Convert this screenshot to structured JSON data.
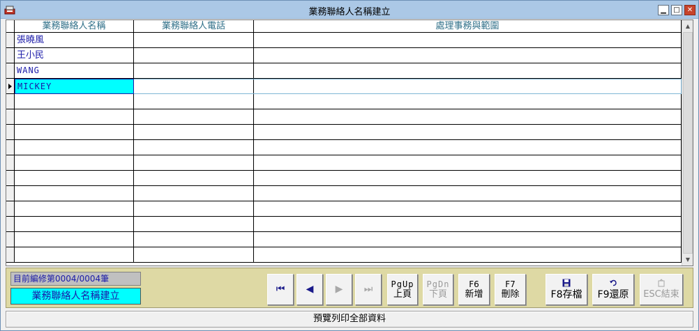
{
  "window": {
    "title": "業務聯絡人名稱建立",
    "min_glyph": "▁",
    "max_glyph": "□",
    "close_glyph": "✕"
  },
  "grid": {
    "headers": [
      "業務聯絡人名稱",
      "業務聯絡人電話",
      "處理事務與範圍"
    ],
    "rows": [
      {
        "name": "張曉風",
        "phone": "",
        "scope": ""
      },
      {
        "name": "王小民",
        "phone": "",
        "scope": ""
      },
      {
        "name": "WANG",
        "phone": "",
        "scope": ""
      },
      {
        "name": "MICKEY",
        "phone": "",
        "scope": ""
      }
    ],
    "selected_row": 3
  },
  "status": {
    "record_info": "目前編修第0004/0004筆",
    "form_name": "業務聯絡人名稱建立"
  },
  "toolbar": {
    "first": "⏮",
    "prev": "◀",
    "next": "▶",
    "last": "⏭",
    "pgup_key": "PgUp",
    "pgup_label": "上頁",
    "pgdn_key": "PgDn",
    "pgdn_label": "下頁",
    "f6_key": "F6",
    "f6_label": "新增",
    "f7_key": "F7",
    "f7_label": "刪除",
    "f8_label": "F8存檔",
    "f9_label": "F9還原",
    "esc_label": "ESC結束"
  },
  "footer": {
    "preview_label": "預覽列印全部資料"
  },
  "colors": {
    "titlebar": "#abc8e6",
    "panel": "#ded9a4",
    "highlight": "#00ffff",
    "header_text": "#2f6f88",
    "cell_text": "#1a1aa8"
  }
}
